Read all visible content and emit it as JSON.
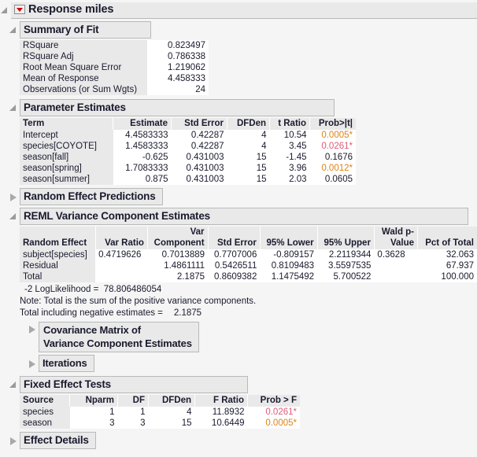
{
  "window": {
    "title": "Response miles",
    "red_triangle_icon": "red-triangle-menu-icon"
  },
  "summary_of_fit": {
    "title": "Summary of Fit",
    "rows": [
      {
        "label": "RSquare",
        "value": "0.823497"
      },
      {
        "label": "RSquare Adj",
        "value": "0.786338"
      },
      {
        "label": "Root Mean Square Error",
        "value": "1.219062"
      },
      {
        "label": "Mean of Response",
        "value": "4.458333"
      },
      {
        "label": "Observations (or Sum Wgts)",
        "value": "24"
      }
    ]
  },
  "parameter_estimates": {
    "title": "Parameter Estimates",
    "columns": [
      "Term",
      "Estimate",
      "Std Error",
      "DFDen",
      "t Ratio",
      "Prob>|t|"
    ],
    "rows": [
      {
        "term": "Intercept",
        "estimate": "4.4583333",
        "std_error": "0.42287",
        "dfden": "4",
        "t_ratio": "10.54",
        "prob": "0.0005*",
        "prob_color": "orange"
      },
      {
        "term": "species[COYOTE]",
        "estimate": "1.4583333",
        "std_error": "0.42287",
        "dfden": "4",
        "t_ratio": "3.45",
        "prob": "0.0261*",
        "prob_color": "pink"
      },
      {
        "term": "season[fall]",
        "estimate": "-0.625",
        "std_error": "0.431003",
        "dfden": "15",
        "t_ratio": "-1.45",
        "prob": "0.1676",
        "prob_color": "none"
      },
      {
        "term": "season[spring]",
        "estimate": "1.7083333",
        "std_error": "0.431003",
        "dfden": "15",
        "t_ratio": "3.96",
        "prob": "0.0012*",
        "prob_color": "orange"
      },
      {
        "term": "season[summer]",
        "estimate": "0.875",
        "std_error": "0.431003",
        "dfden": "15",
        "t_ratio": "2.03",
        "prob": "0.0605",
        "prob_color": "none"
      }
    ]
  },
  "random_effect_predictions": {
    "title": "Random Effect Predictions"
  },
  "reml": {
    "title": "REML Variance Component Estimates",
    "columns": {
      "random_effect": "Random Effect",
      "var_ratio": "Var Ratio",
      "var_component_l1": "Var",
      "var_component_l2": "Component",
      "std_error": "Std Error",
      "lower": "95% Lower",
      "upper": "95% Upper",
      "wald_l1": "Wald p-",
      "wald_l2": "Value",
      "pct_of_total": "Pct of Total"
    },
    "rows": [
      {
        "effect": "subject[species]",
        "var_ratio": "0.4719626",
        "var_component": "0.7013889",
        "std_error": "0.7707006",
        "lower": "-0.809157",
        "upper": "2.2119344",
        "wald": "0.3628",
        "pct": "32.063"
      },
      {
        "effect": "Residual",
        "var_ratio": "",
        "var_component": "1.4861111",
        "std_error": "0.5426511",
        "lower": "0.8109483",
        "upper": "3.5597535",
        "wald": "",
        "pct": "67.937"
      },
      {
        "effect": "Total",
        "var_ratio": "",
        "var_component": "2.1875",
        "std_error": "0.8609382",
        "lower": "1.1475492",
        "upper": "5.700522",
        "wald": "",
        "pct": "100.000"
      }
    ],
    "loglikelihood": "-2 LogLikelihood =  78.806486054",
    "note": "Note: Total is the sum of the positive variance components.",
    "total_including_negative_label": "Total including negative estimates = ",
    "total_including_negative_value": "2.1875"
  },
  "covariance_matrix": {
    "title_line1": "Covariance Matrix of",
    "title_line2": "Variance Component Estimates"
  },
  "iterations": {
    "title": "Iterations"
  },
  "fixed_effect_tests": {
    "title": "Fixed Effect Tests",
    "columns": [
      "Source",
      "Nparm",
      "DF",
      "DFDen",
      "F Ratio",
      "Prob > F"
    ],
    "rows": [
      {
        "source": "species",
        "nparm": "1",
        "df": "1",
        "dfden": "4",
        "f_ratio": "11.8932",
        "prob": "0.0261*",
        "prob_color": "pink"
      },
      {
        "source": "season",
        "nparm": "3",
        "df": "3",
        "dfden": "15",
        "f_ratio": "10.6449",
        "prob": "0.0005*",
        "prob_color": "orange"
      }
    ]
  },
  "effect_details": {
    "title": "Effect Details"
  },
  "colors": {
    "significant_orange": "#e08214",
    "significant_pink": "#e05b7a",
    "header_gray": "#e9e9e9",
    "border_gray": "#b9b9b9",
    "page_bg": "#f5f5f5",
    "text": "#1a1a2e"
  }
}
